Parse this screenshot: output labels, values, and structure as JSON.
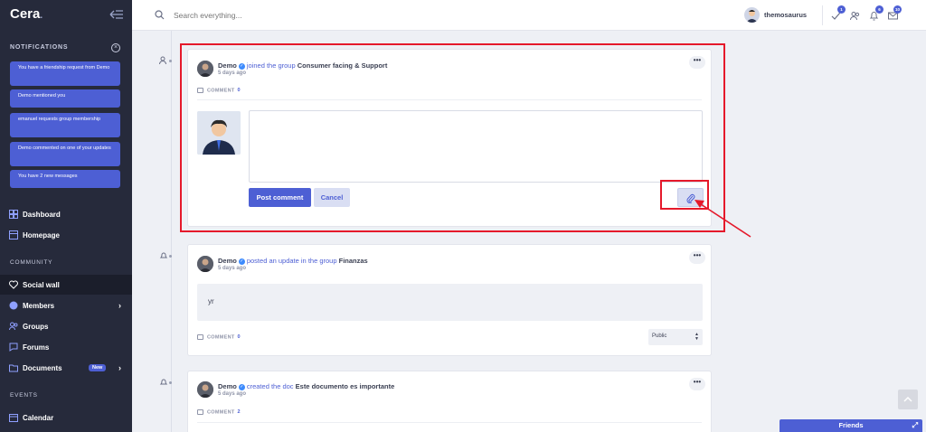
{
  "app": {
    "logo": "Cera",
    "logo_dot": "."
  },
  "sidebar": {
    "notifications_title": "NOTIFICATIONS",
    "notifications": [
      "You have a friendship request from Demo",
      "Demo mentioned you",
      "emanuel requests group membership",
      "Demo commented on one of your updates",
      "You have 2 new messages"
    ],
    "nav_top": [
      {
        "label": "Dashboard",
        "icon": "dashboard-icon"
      },
      {
        "label": "Homepage",
        "icon": "homepage-icon"
      }
    ],
    "community_title": "COMMUNITY",
    "community": [
      {
        "label": "Social wall",
        "icon": "heart-icon",
        "active": true
      },
      {
        "label": "Members",
        "icon": "globe-icon",
        "chevron": true
      },
      {
        "label": "Groups",
        "icon": "groups-icon"
      },
      {
        "label": "Forums",
        "icon": "forums-icon"
      },
      {
        "label": "Documents",
        "icon": "folder-icon",
        "badge": "New",
        "chevron": true
      }
    ],
    "events_title": "EVENTS",
    "events": [
      {
        "label": "Calendar",
        "icon": "calendar-icon"
      }
    ]
  },
  "header": {
    "search_placeholder": "Search everything...",
    "user_name": "themosaurus",
    "badges": {
      "check": "1",
      "friends": "",
      "bell": "6",
      "messages": "10"
    }
  },
  "feed": {
    "activity1": {
      "author": "Demo",
      "action": "joined the group",
      "object": "Consumer facing & Support",
      "time": "5 days ago",
      "comment_label": "COMMENT",
      "comment_count": "0",
      "post_button": "Post comment",
      "cancel_button": "Cancel",
      "more": "•••"
    },
    "activity2": {
      "author": "Demo",
      "action": "posted an update in the group",
      "object": "Finanzas",
      "time": "5 days ago",
      "body": "yr",
      "comment_label": "COMMENT",
      "comment_count": "0",
      "privacy": "Public",
      "more": "•••"
    },
    "activity3": {
      "author": "Demo",
      "action": "created the doc",
      "object": "Este documento es importante",
      "time": "5 days ago",
      "comment_label": "COMMENT",
      "comment_count": "2",
      "more": "•••"
    }
  },
  "friends_bar": {
    "label": "Friends",
    "expand": "⤢"
  },
  "colors": {
    "accent": "#4d5fd4",
    "sidebar": "#262a3b",
    "annotation": "#e5192b"
  }
}
